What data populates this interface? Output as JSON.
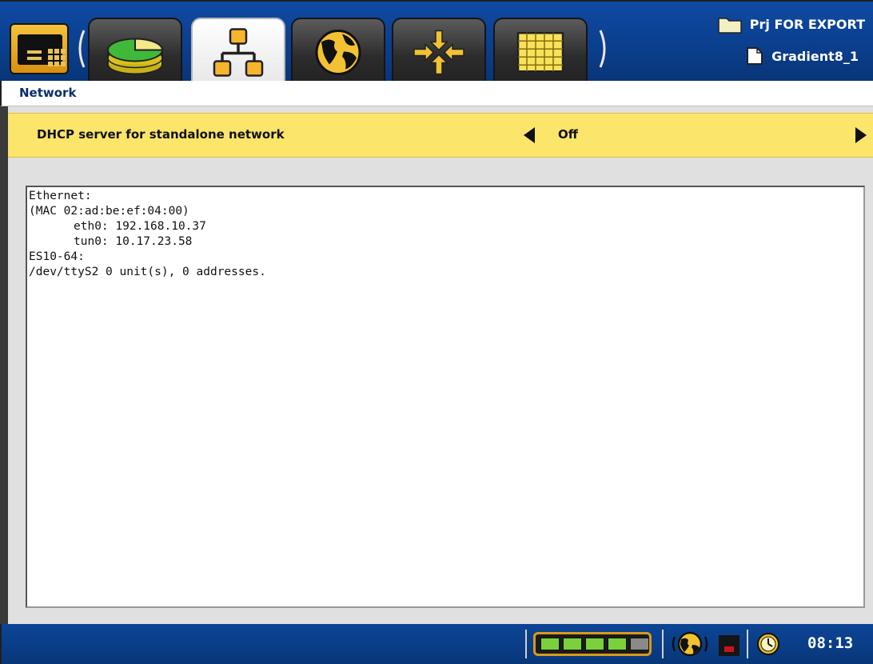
{
  "project": {
    "folder_name": "Prj FOR EXPORT",
    "file_name": "Gradient8_1"
  },
  "tabs": [
    {
      "icon": "pie-chart-icon",
      "active": false
    },
    {
      "icon": "network-icon",
      "active": true
    },
    {
      "icon": "globe-icon",
      "active": false
    },
    {
      "icon": "arrows-converge-icon",
      "active": false
    },
    {
      "icon": "grid-icon",
      "active": false
    }
  ],
  "breadcrumb": "Network",
  "setting": {
    "label": "DHCP server for standalone network",
    "value": "Off"
  },
  "info_text": {
    "lines": [
      "Ethernet:",
      "(MAC 02:ad:be:ef:04:00)",
      "eth0: 192.168.10.37",
      "tun0: 10.17.23.58",
      "ES10-64:",
      "/dev/ttyS2 0 unit(s), 0 addresses."
    ]
  },
  "status": {
    "battery_level_fraction": 0.8,
    "time": "08:13"
  },
  "colors": {
    "header_blue": "#0b3f8e",
    "setting_yellow": "#fbe56a",
    "accent_orange": "#d98f10",
    "battery_green": "#7bd13b"
  }
}
